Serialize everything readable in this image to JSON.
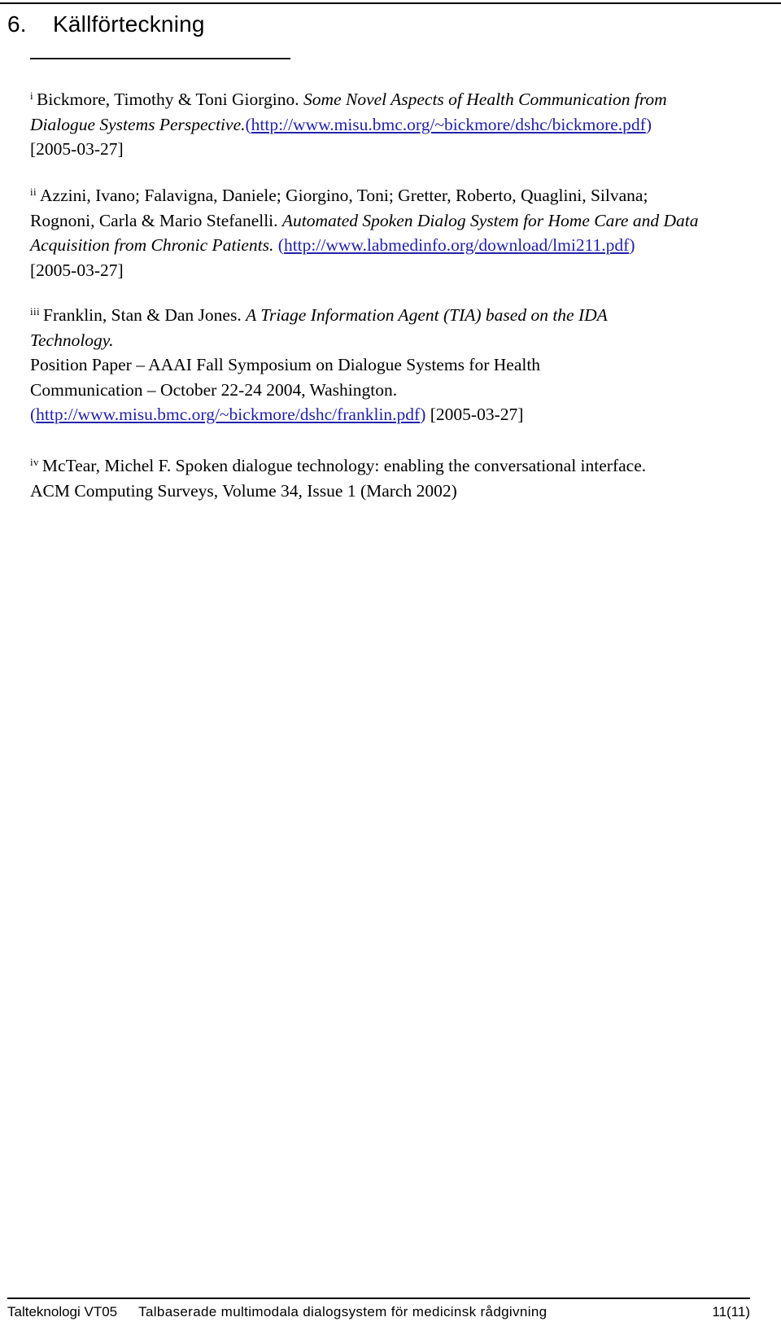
{
  "document": {
    "heading_number": "6.",
    "heading_title": "Källförteckning",
    "accent_link_color": "#2222aa",
    "text_color": "#000000"
  },
  "references": [
    {
      "marker": "i",
      "authors": "Bickmore, Timothy & Toni Giorgino.",
      "title": "Some Novel Aspects of Health Communication from Dialogue Systems Perspective.",
      "title_line1": "Some Novel Aspects of Health Communication from",
      "title_line2": "Dialogue Systems Perspective.",
      "open_paren": "(",
      "url": "http://www.misu.bmc.org/~bickmore/dshc/bickmore",
      "url_tail": "pdf",
      "url_full": "http://www.misu.bmc.org/~bickmore/dshc/bickmore.pdf",
      "close_paren": ")",
      "accessed": "[2005-03-27]"
    },
    {
      "marker": "ii",
      "authors_line1": "Azzini, Ivano; Falavigna, Daniele; Giorgino, Toni; Gretter, Roberto, Quaglini, Silvana;",
      "authors_line2": "Rognoni, Carla & Mario Stefanelli.",
      "title_line1": "Automated Spoken Dialog System for Home Care and Data",
      "title_line2": "Acquisition from Chronic Patients.",
      "open_paren": "(",
      "url_full": "http://www.labmedinfo.org/download/lmi211.pdf",
      "close_paren": ")",
      "accessed": "[2005-03-27]"
    },
    {
      "marker": "iii",
      "authors": "Franklin, Stan & Dan Jones.",
      "title_line1": "A Triage Information Agent (TIA) based on the IDA",
      "title_line2": "Technology.",
      "venue_line1": "Position Paper – AAAI Fall Symposium on Dialogue Systems for Health",
      "venue_line2": "Communication – October 22-24 2004, Washington.",
      "open_paren": "(",
      "url_full": "http://www.misu.bmc.org/~bickmore/dshc/franklin.pdf",
      "close_paren": ")",
      "accessed": "[2005-03-27]"
    },
    {
      "marker": "iv",
      "line1": "McTear, Michel F. Spoken dialogue technology: enabling the conversational interface.",
      "line2": "ACM Computing Surveys, Volume 34, Issue 1 (March 2002)"
    }
  ],
  "footer": {
    "left": "Talteknologi VT05",
    "center": "Talbaserade multimodala dialogsystem för medicinsk rådgivning",
    "page": "11(11)"
  }
}
